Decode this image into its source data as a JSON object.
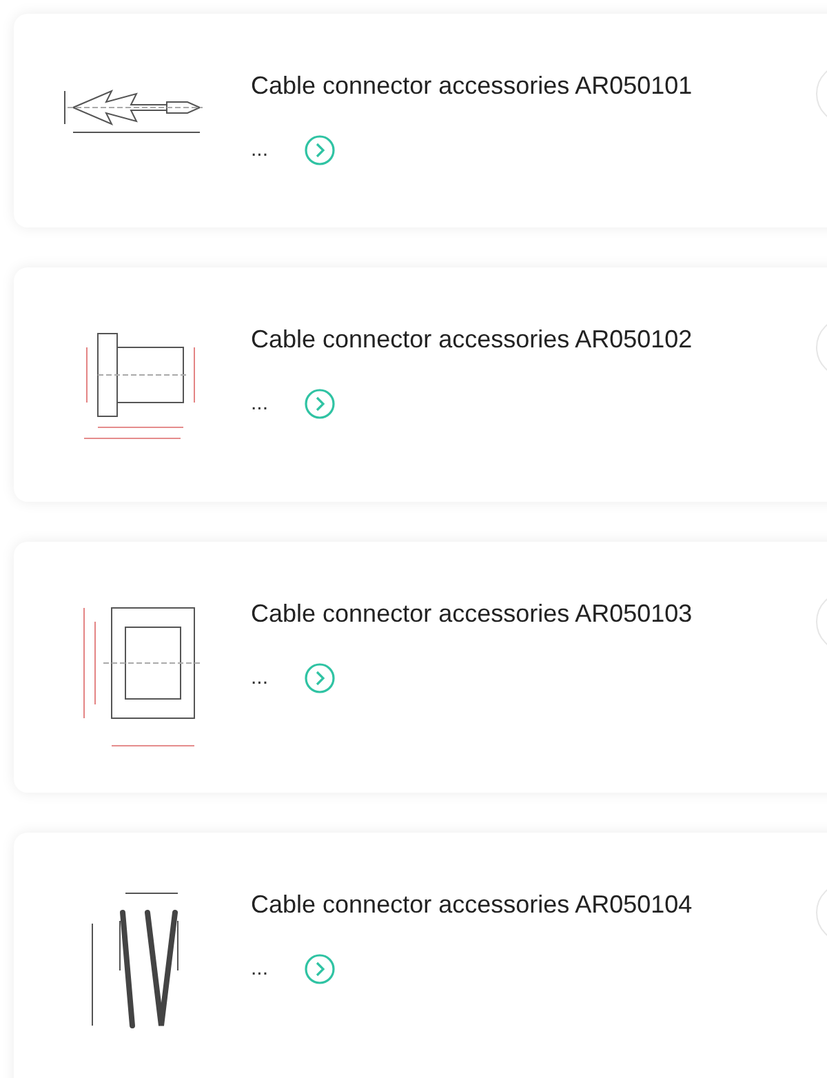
{
  "products": [
    {
      "title": "Cable connector accessories AR050101",
      "excerpt": "..."
    },
    {
      "title": "Cable connector accessories AR050102",
      "excerpt": "..."
    },
    {
      "title": "Cable connector accessories AR050103",
      "excerpt": "..."
    },
    {
      "title": "Cable connector accessories AR050104",
      "excerpt": "..."
    }
  ]
}
